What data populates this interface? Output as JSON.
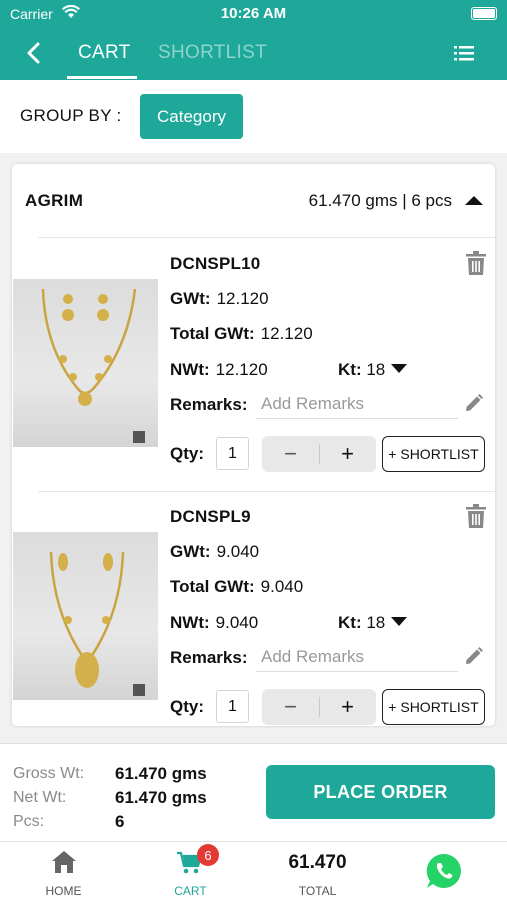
{
  "status_bar": {
    "carrier": "Carrier",
    "time": "10:26 AM"
  },
  "nav": {
    "tab_cart": "CART",
    "tab_shortlist": "SHORTLIST"
  },
  "group_by": {
    "label": "GROUP BY :",
    "button": "Category"
  },
  "group": {
    "name": "AGRIM",
    "summary": "61.470 gms | 6 pcs",
    "items": [
      {
        "sku": "DCNSPL10",
        "gwt_label": "GWt:",
        "gwt": "12.120",
        "total_gwt_label": "Total GWt:",
        "total_gwt": "12.120",
        "nwt_label": "NWt:",
        "nwt": "12.120",
        "kt_label": "Kt:",
        "kt": "18",
        "remarks_label": "Remarks:",
        "remarks_placeholder": "Add Remarks",
        "qty_label": "Qty:",
        "qty": "1",
        "minus": "−",
        "plus": "+",
        "shortlist": "+ SHORTLIST"
      },
      {
        "sku": "DCNSPL9",
        "gwt_label": "GWt:",
        "gwt": "9.040",
        "total_gwt_label": "Total GWt:",
        "total_gwt": "9.040",
        "nwt_label": "NWt:",
        "nwt": "9.040",
        "kt_label": "Kt:",
        "kt": "18",
        "remarks_label": "Remarks:",
        "remarks_placeholder": "Add Remarks",
        "qty_label": "Qty:",
        "qty": "1",
        "minus": "−",
        "plus": "+",
        "shortlist": "+ SHORTLIST"
      }
    ]
  },
  "footer": {
    "gross_label": "Gross Wt:",
    "gross": "61.470 gms",
    "net_label": "Net Wt:",
    "net": "61.470 gms",
    "pcs_label": "Pcs:",
    "pcs": "6",
    "place_order": "PLACE ORDER"
  },
  "bottom_nav": {
    "home": "HOME",
    "cart": "CART",
    "cart_badge": "6",
    "total_value": "61.470",
    "total": "TOTAL"
  },
  "colors": {
    "primary": "#1ea899",
    "badge": "#e53935",
    "whatsapp": "#25d366"
  }
}
